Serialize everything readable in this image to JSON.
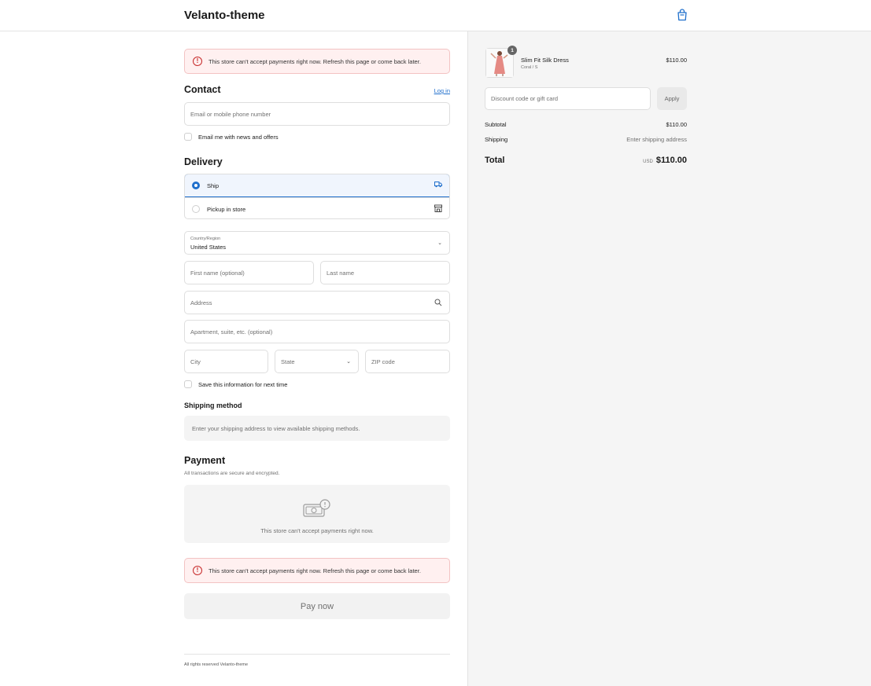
{
  "header": {
    "brand": "Velanto-theme",
    "cart_icon": "shopping-bag-icon"
  },
  "alerts": {
    "top": "This store can't accept payments right now. Refresh this page or come back later.",
    "bottom": "This store can't accept payments right now. Refresh this page or come back later."
  },
  "contact": {
    "title": "Contact",
    "login": "Log in",
    "email_placeholder": "Email or mobile phone number",
    "news_label": "Email me with news and offers"
  },
  "delivery": {
    "title": "Delivery",
    "options": [
      {
        "label": "Ship",
        "selected": true,
        "icon": "truck-icon"
      },
      {
        "label": "Pickup in store",
        "selected": false,
        "icon": "store-icon"
      }
    ],
    "country_label": "Country/Region",
    "country_value": "United States",
    "first_name": "First name (optional)",
    "last_name": "Last name",
    "address": "Address",
    "apartment": "Apartment, suite, etc. (optional)",
    "city": "City",
    "state": "State",
    "zip": "ZIP code",
    "save_label": "Save this information for next time"
  },
  "shipping_method": {
    "title": "Shipping method",
    "message": "Enter your shipping address to view available shipping methods."
  },
  "payment": {
    "title": "Payment",
    "subtitle": "All transactions are secure and encrypted.",
    "unavailable": "This store can't accept payments right now.",
    "pay_now": "Pay now"
  },
  "footer": {
    "text": "All rights reserved Velanto-theme"
  },
  "order": {
    "quantity": "1",
    "product_name": "Slim Fit Silk Dress",
    "variant": "Coral / S",
    "price": "$110.00",
    "discount_placeholder": "Discount code or gift card",
    "apply": "Apply",
    "subtotal_label": "Subtotal",
    "subtotal_value": "$110.00",
    "shipping_label": "Shipping",
    "shipping_value": "Enter shipping address",
    "total_label": "Total",
    "currency": "USD",
    "total_value": "$110.00"
  },
  "colors": {
    "accent": "#1f6fcc",
    "error": "#c62828",
    "sidebar_bg": "#f5f5f5"
  }
}
